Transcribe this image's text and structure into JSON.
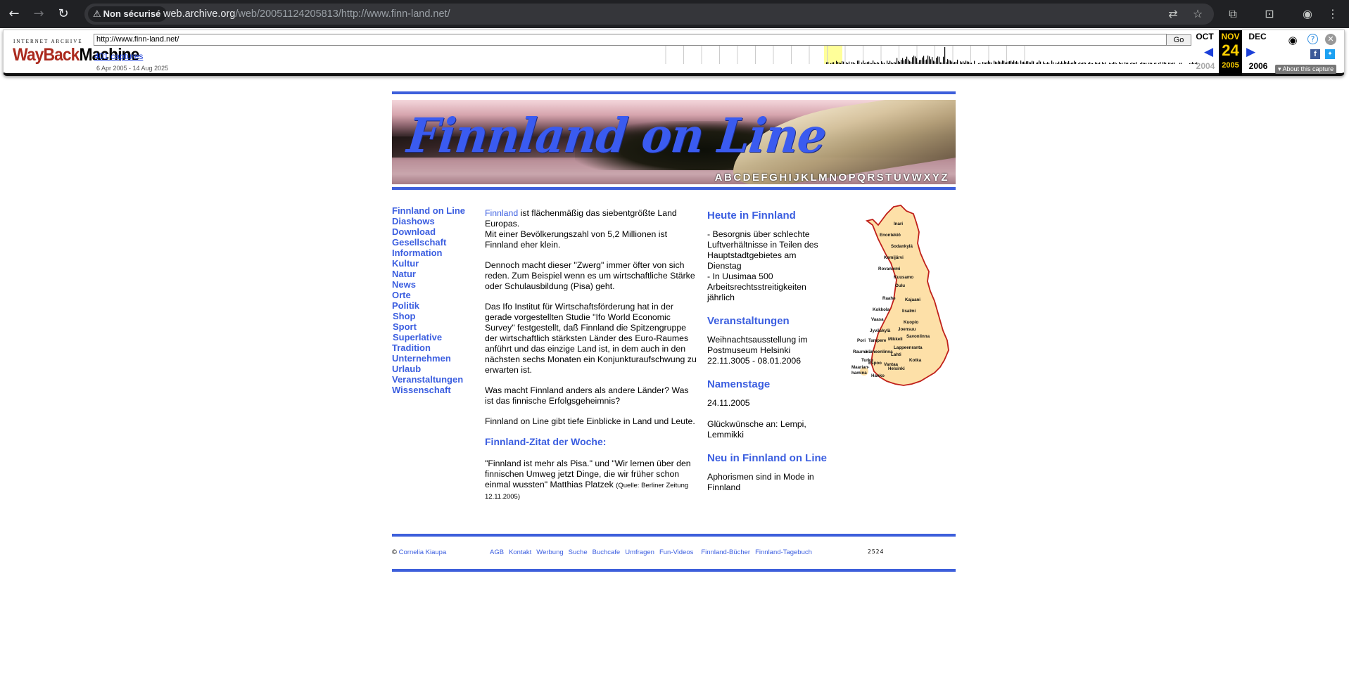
{
  "browser": {
    "security_label": "Non sécurisé",
    "url_host": "web.archive.org",
    "url_path": "/web/20051124205813/http://www.finn-land.net/"
  },
  "wayback": {
    "logo_top": "INTERNET ARCHIVE",
    "logo_way": "WayBack",
    "logo_machine": "Machine",
    "url_value": "http://www.finn-land.net/",
    "go_label": "Go",
    "captures": "401 captures",
    "range": "6 Apr 2005 - 14 Aug 2025",
    "prev_month": "OCT",
    "cur_month": "NOV",
    "cur_day": "24",
    "cur_year": "2005",
    "next_month": "DEC",
    "prev_year": "2004",
    "next_year": "2006",
    "about": "About this capture",
    "arrow_prev": "◀",
    "arrow_next": "▶"
  },
  "banner": {
    "title": "Finnland on Line",
    "alphabet": "ABCDEFGHIJKLMNOPQRSTUVWXYZ"
  },
  "nav": {
    "items": [
      "Finnland on Line",
      "Diashows",
      "Download",
      "Gesellschaft",
      "Information",
      "Kultur",
      "Natur",
      "News",
      "Orte",
      "Politik",
      "Shop",
      "Sport",
      "Superlative",
      "Tradition",
      "Unternehmen",
      "Urlaub",
      "Veranstaltungen",
      "Wissenschaft"
    ]
  },
  "main": {
    "p1_link": "Finnland",
    "p1_rest": " ist flächenmäßig das siebentgrößte Land Europas.",
    "p1_line2": "Mit einer Bevölkerungszahl von 5,2 Millionen ist Finnland eher klein.",
    "p2": "Dennoch macht dieser \"Zwerg\" immer öfter von sich reden. Zum Beispiel wenn es um wirtschaftliche Stärke oder Schulausbildung (Pisa) geht.",
    "p3": "Das Ifo Institut für Wirtschaftsförderung hat in der gerade vorgestellten Studie \"Ifo World Economic Survey\" festgestellt, daß Finnland die Spitzengruppe der wirtschaftlich stärksten Länder des Euro-Raumes anführt und das einzige Land ist, in dem auch in den nächsten sechs Monaten ein Konjunkturaufschwung zu erwarten ist.",
    "p4": "Was macht Finnland anders als andere Länder? Was ist das finnische Erfolgsgeheimnis?",
    "p5": "Finnland on Line gibt tiefe Einblicke in Land und Leute.",
    "quote_heading": "Finnland-Zitat der Woche:",
    "quote": "\"Finnland ist mehr als Pisa.\" und \"Wir lernen über den finnischen Umweg jetzt Dinge, die wir früher schon einmal wussten\"  Matthias Platzek ",
    "quote_source": "(Quelle: Berliner Zeitung 12.11.2005)"
  },
  "right": {
    "h_today": "Heute in Finnland",
    "today_1": "- Besorgnis über schlechte Luftverhältnisse in Teilen des Hauptstadtgebietes am Dienstag",
    "today_2": "- In Uusimaa 500 Arbeitsrechtsstreitigkeiten jährlich",
    "h_events": "Veranstaltungen",
    "events": "Weihnachtsausstellung im Postmuseum Helsinki",
    "events_dates": "22.11.3005 - 08.01.2006",
    "h_names": "Namenstage",
    "names_date": "24.11.2005",
    "names_text": "Glückwünsche an:  Lempi, Lemmikki",
    "h_new": "Neu in Finnland on Line",
    "new_text": "Aphorismen sind in Mode in Finnland"
  },
  "map": {
    "cities": [
      "Inari",
      "Enontekiö",
      "Sodankylä",
      "Kemijärvi",
      "Rovaniemi",
      "Kuusamo",
      "Oulu",
      "Raahe",
      "Kajaani",
      "Kokkola",
      "Iisalmi",
      "Vaasa",
      "Kuopio",
      "Jyväskylä",
      "Joensuu",
      "Pori",
      "Tampere",
      "Mikkeli",
      "Savonlinna",
      "Rauma",
      "Hämeenlinna",
      "Lappeenranta",
      "Turku",
      "Lahti",
      "Kotka",
      "Maarian-",
      "hamina",
      "Espoo",
      "Vantaa",
      "Helsinki",
      "Hanko"
    ]
  },
  "footer": {
    "copyright": "©",
    "author": "Cornelia Kiaupa",
    "links": [
      "AGB",
      "Kontakt",
      "Werbung",
      "Suche",
      "Buchcafe",
      "Umfragen",
      "Fun-Videos",
      "Finnland-Bücher",
      "Finnland-Tagebuch"
    ],
    "counter": "2524"
  }
}
